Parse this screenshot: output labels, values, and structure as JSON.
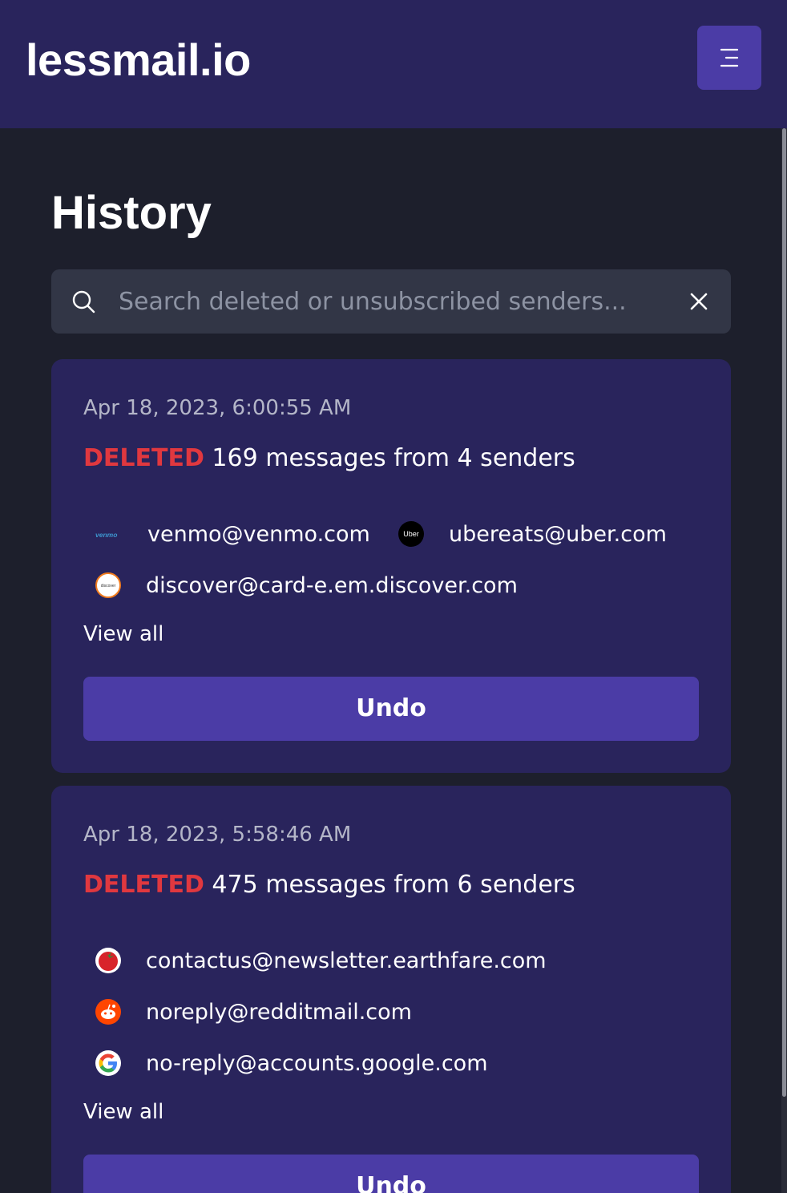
{
  "header": {
    "brand": "lessmail.io",
    "menu_icon": "menu-icon"
  },
  "page": {
    "title": "History"
  },
  "search": {
    "placeholder": "Search deleted or unsubscribed senders...",
    "value": "",
    "icon": "search-icon",
    "clear_icon": "close-icon"
  },
  "history": [
    {
      "timestamp": "Apr 18, 2023, 6:00:55 AM",
      "action": "DELETED",
      "summary": "169 messages from 4 senders",
      "senders": [
        {
          "email": "venmo@venmo.com",
          "icon": "venmo-logo-icon",
          "logo_text": "venmo"
        },
        {
          "email": "ubereats@uber.com",
          "icon": "uber-logo-icon",
          "logo_text": "Uber"
        },
        {
          "email": "discover@card-e.em.discover.com",
          "icon": "discover-logo-icon",
          "logo_text": "discover"
        }
      ],
      "view_all": "View all",
      "undo": "Undo"
    },
    {
      "timestamp": "Apr 18, 2023, 5:58:46 AM",
      "action": "DELETED",
      "summary": "475 messages from 6 senders",
      "senders": [
        {
          "email": "contactus@newsletter.earthfare.com",
          "icon": "earthfare-logo-icon"
        },
        {
          "email": "noreply@redditmail.com",
          "icon": "reddit-logo-icon"
        },
        {
          "email": "no-reply@accounts.google.com",
          "icon": "google-logo-icon"
        }
      ],
      "view_all": "View all",
      "undo": "Undo"
    }
  ],
  "colors": {
    "header_bg": "#29245c",
    "page_bg": "#1d1f2c",
    "card_bg": "#29245c",
    "accent": "#4b3ca6",
    "deleted": "#e0383f"
  }
}
